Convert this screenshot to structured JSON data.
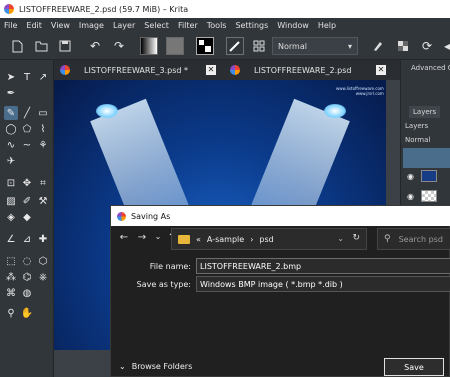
{
  "app": {
    "title": "LISTOFFREEWARE_2.psd (59.7 MiB)  – Krita"
  },
  "menu": [
    "File",
    "Edit",
    "View",
    "Image",
    "Layer",
    "Select",
    "Filter",
    "Tools",
    "Settings",
    "Window",
    "Help"
  ],
  "toolbar": {
    "blend_mode": "Normal"
  },
  "tabs": [
    {
      "label": "LISTOFFREEWARE_3.psd *"
    },
    {
      "label": "LISTOFFREEWARE_2.psd"
    }
  ],
  "canvas": {
    "watermark_line1": "www.listoffreeware.com",
    "watermark_line2": "www.jrsrl.com"
  },
  "right_panel": {
    "advanced": "Advanced Co",
    "layers_tab": "Layers",
    "layers_label": "Layers",
    "mode": "Normal"
  },
  "dialog": {
    "title": "Saving As",
    "breadcrumbs": [
      "«",
      "A-sample",
      "›",
      "psd"
    ],
    "search_placeholder": "Search psd",
    "file_name_label": "File name:",
    "file_name_value": "LISTOFFREEWARE_2.bmp",
    "save_type_label": "Save as type:",
    "save_type_value": "Windows BMP image ( *.bmp *.dib )",
    "browse_folders": "Browse Folders",
    "save_button": "Save"
  },
  "colors": {
    "window_bg": "#31363b",
    "dialog_bg": "#202020",
    "accent": "#4a6d8c"
  }
}
